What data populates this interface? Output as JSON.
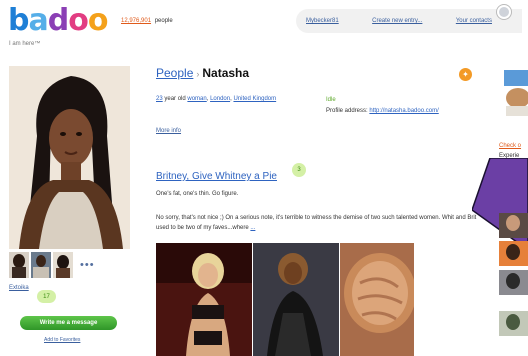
{
  "header": {
    "logo_text": "badoo",
    "tagline": "I am here™",
    "people_count": "12,976,901",
    "people_label": "people",
    "nav": [
      "Mybecker81",
      "Create new entry...",
      "Your contacts"
    ]
  },
  "profile": {
    "breadcrumb_link": "People",
    "breadcrumb_separator": "›",
    "name": "Natasha",
    "age": "23",
    "age_suffix": "year old",
    "gender": "woman",
    "city": "London",
    "country": "United Kingdom",
    "status": "Idle",
    "profile_address_label": "Profile address:",
    "profile_address": "http://natasha.badoo.com/",
    "more_info": "More info",
    "photos_more": "•••",
    "extoika": "Extoika",
    "photo_count": "17",
    "message_button": "Write me a message",
    "add_favorites": "Add to Favorites"
  },
  "post": {
    "title": "Britney, Give Whitney a Pie",
    "comment_count": "3",
    "subtitle": "One's fat, one's thin. Go figure.",
    "body": "No sorry, that's not nice ;) On a serious note, it's terrible to witness the demise of two such talented women. Whit and Brit used to be two of my faves...where",
    "more_link": "..."
  },
  "sidebar": {
    "check_link": "Check o",
    "experience": "Experie"
  },
  "colors": {
    "link": "#2e63c0",
    "accent_orange": "#e05a1a",
    "button_green": "#3fad35",
    "badge_green": "#d4f0a6",
    "purple_overlay": "#6b3fa5"
  }
}
